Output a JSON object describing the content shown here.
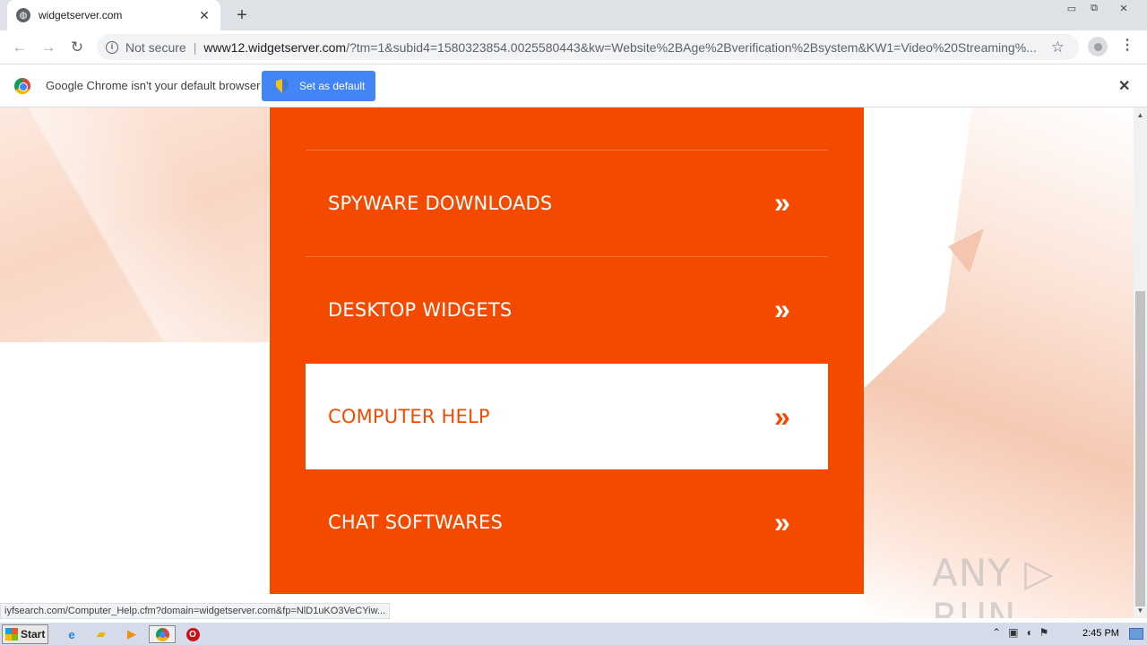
{
  "browser": {
    "tab_title": "widgetserver.com",
    "tab_close": "✕",
    "new_tab": "+",
    "security_label": "Not secure",
    "url_host": "www12.widgetserver.com",
    "url_path": "/?tm=1&subid4=1580323854.0025580443&kw=Website%2BAge%2Bverification%2Bsystem&KW1=Video%20Streaming%...",
    "window_minimize": "▭",
    "window_maximize": "⧉",
    "window_close": "✕"
  },
  "infobar": {
    "message": "Google Chrome isn't your default browser",
    "button_label": "Set as default",
    "close": "✕"
  },
  "page": {
    "menu_items": [
      {
        "label": "SPYWARE DOWNLOADS",
        "chevron": "»"
      },
      {
        "label": "DESKTOP WIDGETS",
        "chevron": "»"
      },
      {
        "label": "COMPUTER HELP",
        "chevron": "»",
        "active": true
      },
      {
        "label": "CHAT SOFTWARES",
        "chevron": "»"
      }
    ],
    "watermark": "ANY ▷ RUN"
  },
  "status_url": "iyfsearch.com/Computer_Help.cfm?domain=widgetserver.com&fp=NlD1uKO3VeCYiw...",
  "taskbar": {
    "start_label": "Start",
    "clock": "2:45 PM"
  },
  "colors": {
    "panel": "#f34a00",
    "button_blue": "#4285f4"
  }
}
